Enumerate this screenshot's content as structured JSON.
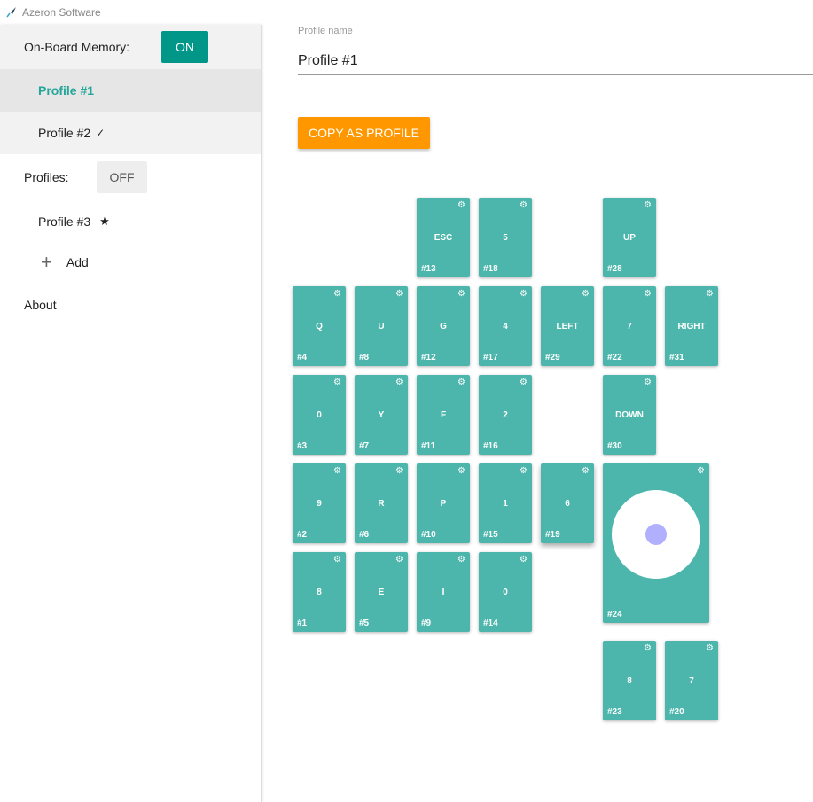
{
  "app": {
    "title": "Azeron Software"
  },
  "sidebar": {
    "onboard_label": "On-Board Memory:",
    "onboard_toggle": "ON",
    "onboard_profiles": [
      {
        "label": "Profile #1",
        "active": true
      },
      {
        "label": "Profile #2",
        "mark": "✓"
      }
    ],
    "profiles_label": "Profiles:",
    "profiles_toggle": "OFF",
    "profiles": [
      {
        "label": "Profile #3",
        "mark": "★"
      }
    ],
    "add_label": "Add",
    "about_label": "About"
  },
  "main": {
    "profile_name_label": "Profile name",
    "profile_name_value": "Profile #1",
    "copy_button": "COPY AS PROFILE"
  },
  "colors": {
    "key": "#4db6ac",
    "accent": "#009688",
    "copy": "#ff9800"
  },
  "keys": [
    {
      "label": "ESC",
      "id": "#13"
    },
    {
      "label": "5",
      "id": "#18"
    },
    {
      "label": "UP",
      "id": "#28"
    },
    {
      "label": "Q",
      "id": "#4"
    },
    {
      "label": "U",
      "id": "#8"
    },
    {
      "label": "G",
      "id": "#12"
    },
    {
      "label": "4",
      "id": "#17"
    },
    {
      "label": "LEFT",
      "id": "#29"
    },
    {
      "label": "7",
      "id": "#22"
    },
    {
      "label": "RIGHT",
      "id": "#31"
    },
    {
      "label": "0",
      "id": "#3"
    },
    {
      "label": "Y",
      "id": "#7"
    },
    {
      "label": "F",
      "id": "#11"
    },
    {
      "label": "2",
      "id": "#16"
    },
    {
      "label": "DOWN",
      "id": "#30"
    },
    {
      "label": "9",
      "id": "#2"
    },
    {
      "label": "R",
      "id": "#6"
    },
    {
      "label": "P",
      "id": "#10"
    },
    {
      "label": "1",
      "id": "#15"
    },
    {
      "label": "6",
      "id": "#19"
    },
    {
      "label": "8",
      "id": "#1"
    },
    {
      "label": "E",
      "id": "#5"
    },
    {
      "label": "I",
      "id": "#9"
    },
    {
      "label": "0",
      "id": "#14"
    },
    {
      "label": "8",
      "id": "#23"
    },
    {
      "label": "7",
      "id": "#20"
    }
  ],
  "joystick": {
    "id": "#24"
  }
}
